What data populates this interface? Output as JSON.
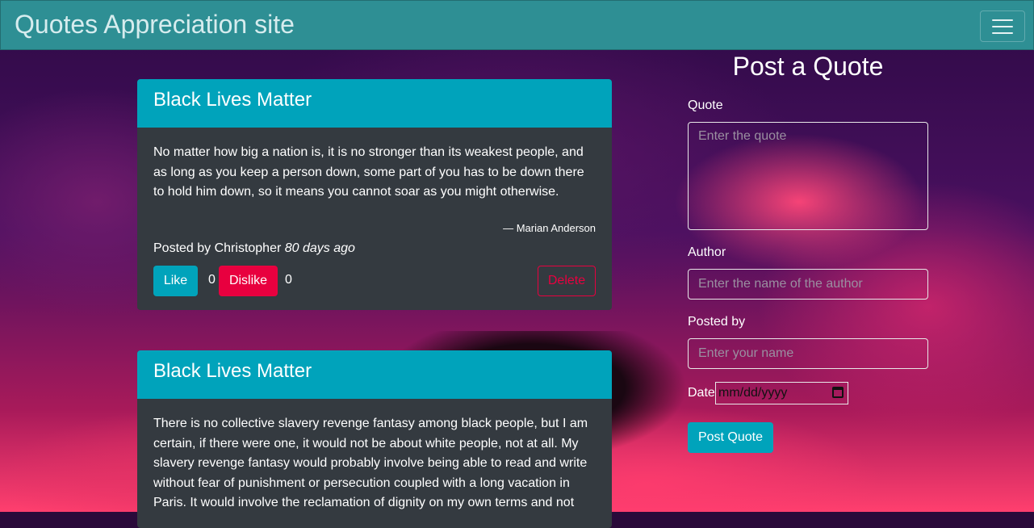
{
  "navbar": {
    "brand": "Quotes Appreciation site",
    "toggler_icon": "hamburger-menu-icon"
  },
  "quotes": [
    {
      "title": "Black Lives Matter",
      "text": "No matter how big a nation is, it is no stronger than its weakest people, and as long as you keep a person down, some part of you has to be down there to hold him down, so it means you cannot soar as you might otherwise.",
      "author": "— Marian Anderson",
      "posted_prefix": "Posted by Christopher",
      "posted_time": "80 days ago",
      "like_label": "Like",
      "like_count": "0",
      "dislike_label": "Dislike",
      "dislike_count": "0",
      "delete_label": "Delete"
    },
    {
      "title": "Black Lives Matter",
      "text": "There is no collective slavery revenge fantasy among black people, but I am certain, if there were one, it would not be about white people, not at all. My slavery revenge fantasy would probably involve being able to read and write without fear of punishment or persecution coupled with a long vacation in Paris. It would involve the reclamation of dignity on my own terms and not"
    }
  ],
  "form": {
    "title": "Post a Quote",
    "quote_label": "Quote",
    "quote_placeholder": "Enter the quote",
    "author_label": "Author",
    "author_placeholder": "Enter the name of the author",
    "posted_by_label": "Posted by",
    "posted_by_placeholder": "Enter your name",
    "date_label": "Date",
    "date_placeholder": "mm/dd/yyyy",
    "submit_label": "Post Quote"
  },
  "colors": {
    "navbar": "#2e8f94",
    "card_header": "#00a3bb",
    "card_body": "#343a40",
    "danger": "#e8003f"
  }
}
